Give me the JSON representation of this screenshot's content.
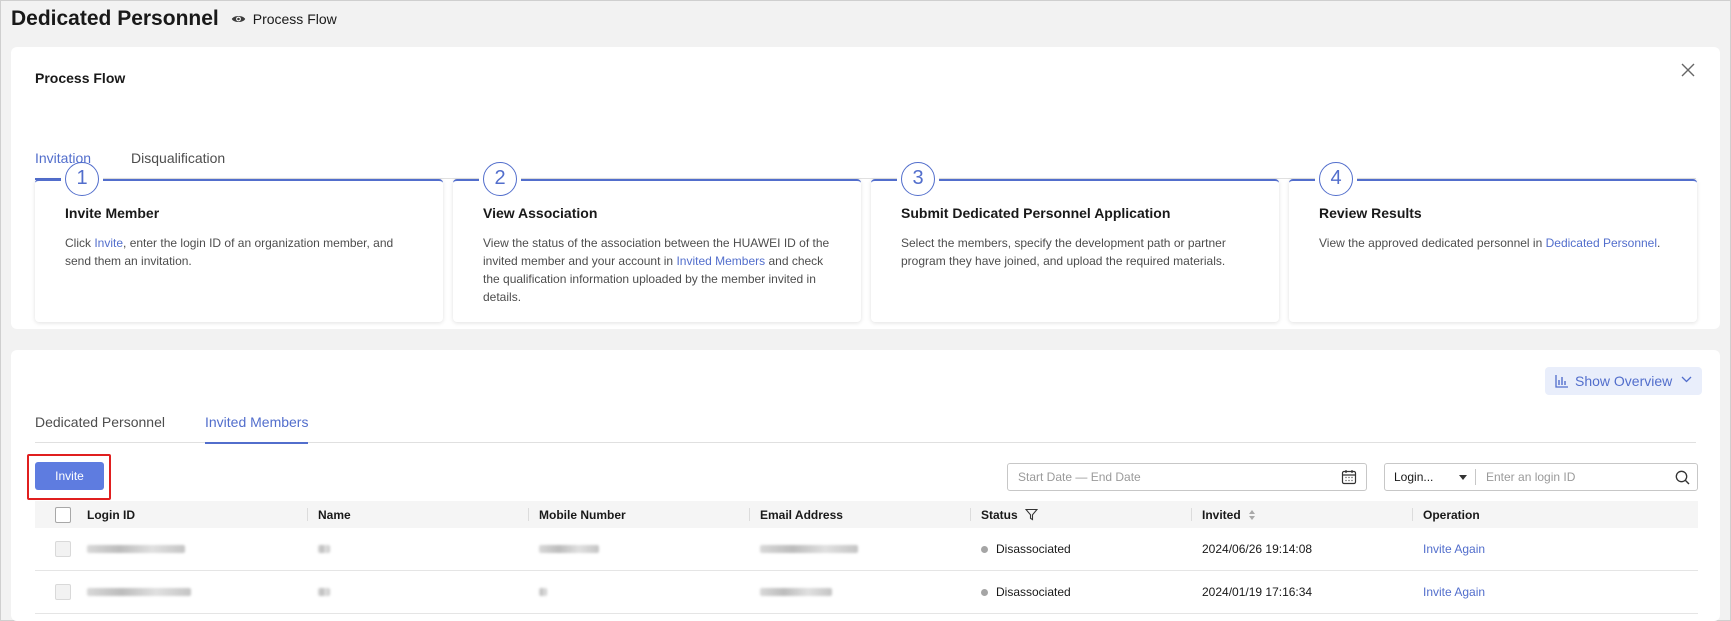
{
  "page": {
    "title": "Dedicated Personnel",
    "process_flow_link": "Process Flow"
  },
  "process_flow": {
    "title": "Process Flow",
    "tabs": [
      {
        "label": "Invitation",
        "active": true
      },
      {
        "label": "Disqualification",
        "active": false
      }
    ],
    "steps": [
      {
        "number": "1",
        "title": "Invite Member",
        "desc_pre": "Click ",
        "desc_link": "Invite",
        "desc_post": ", enter the login ID of an organization member, and send them an invitation."
      },
      {
        "number": "2",
        "title": "View Association",
        "desc_pre": "View the status of the association between the HUAWEI ID of the invited member and your account in ",
        "desc_link": "Invited Members",
        "desc_post": " and check the qualification information uploaded by the member invited in details."
      },
      {
        "number": "3",
        "title": "Submit Dedicated Personnel Application",
        "desc_pre": "Select the members, specify the development path or partner program they have joined, and upload the required materials.",
        "desc_link": "",
        "desc_post": ""
      },
      {
        "number": "4",
        "title": "Review Results",
        "desc_pre": "View the approved dedicated personnel in ",
        "desc_link": "Dedicated Personnel",
        "desc_post": "."
      }
    ]
  },
  "members": {
    "overview_button": "Show Overview",
    "tabs": [
      {
        "label": "Dedicated Personnel",
        "active": false
      },
      {
        "label": "Invited Members",
        "active": true
      }
    ],
    "invite_button": "Invite",
    "date_range_placeholder": "Start Date — End Date",
    "search_field_select": "Login...",
    "search_placeholder": "Enter an login ID",
    "columns": [
      "Login ID",
      "Name",
      "Mobile Number",
      "Email Address",
      "Status",
      "Invited",
      "Operation"
    ],
    "rows": [
      {
        "status": "Disassociated",
        "invited": "2024/06/26 19:14:08",
        "operation": "Invite Again"
      },
      {
        "status": "Disassociated",
        "invited": "2024/01/19 17:16:34",
        "operation": "Invite Again"
      }
    ]
  },
  "colors": {
    "accent": "#526ecc",
    "button_primary": "#5e7ce0",
    "highlight_box": "#e01f1f",
    "status_dot": "#a5a5a5"
  },
  "icons": {
    "process_flow": "eye-icon",
    "close": "close-icon",
    "overview": "bar-chart-icon",
    "overview_toggle": "chevron-down-icon",
    "calendar": "calendar-icon",
    "search": "search-icon",
    "status_filter": "filter-icon",
    "invited_sort": "sort-icon"
  }
}
